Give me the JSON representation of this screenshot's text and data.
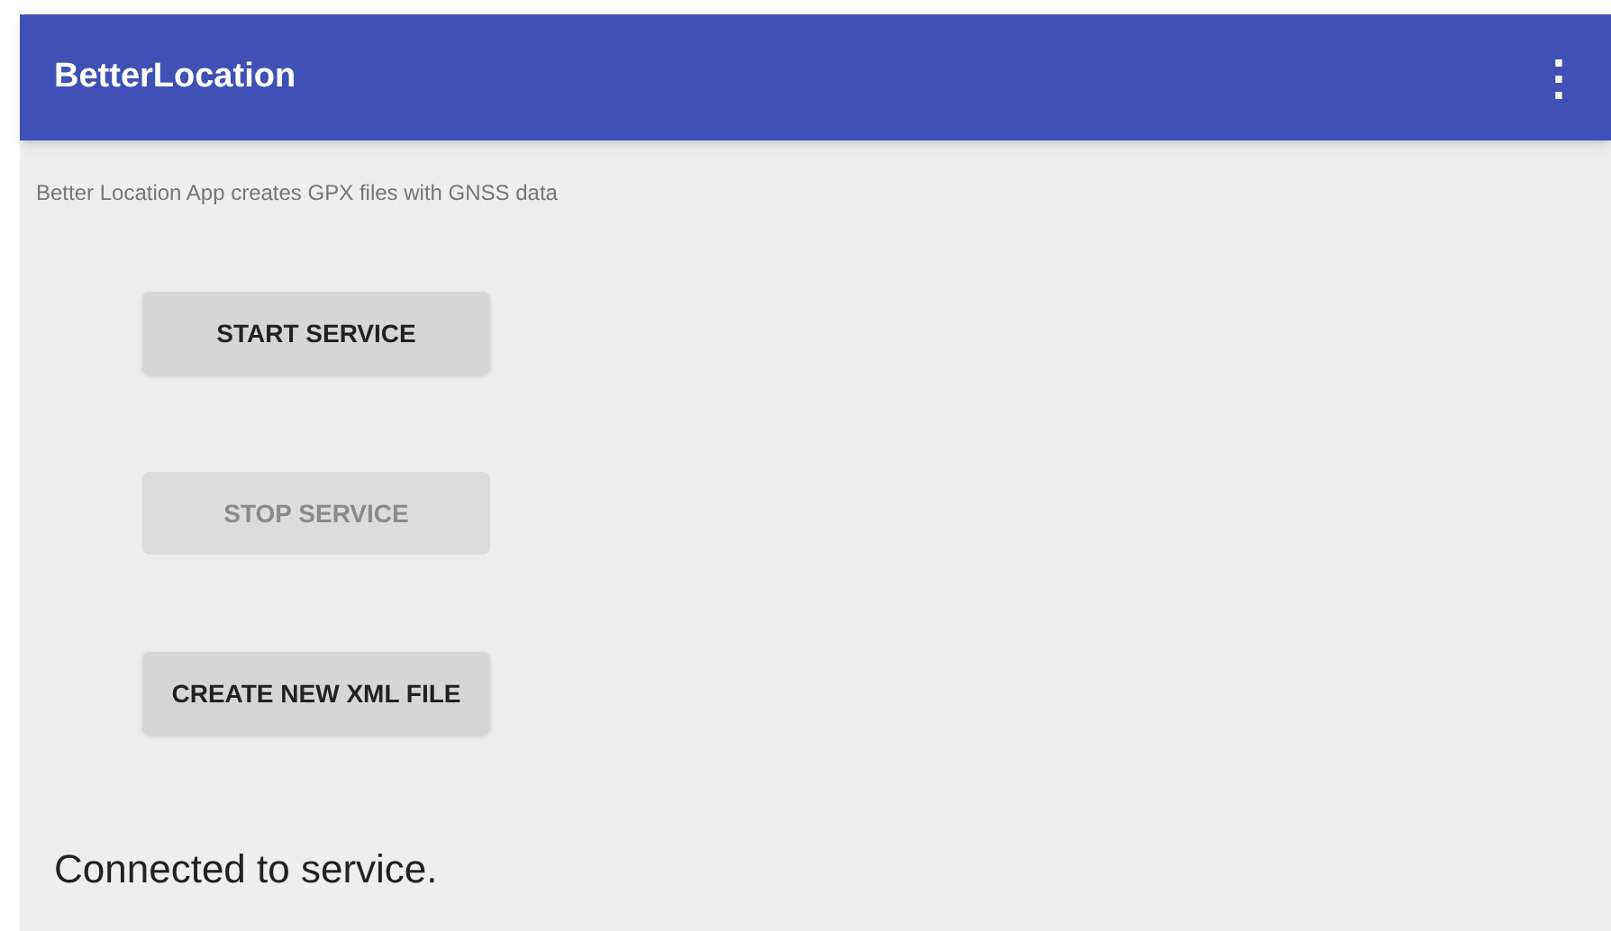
{
  "app_bar": {
    "title": "BetterLocation",
    "menu_icon": "⋮"
  },
  "description": "Better Location App creates GPX files with GNSS data",
  "buttons": [
    {
      "label": "START SERVICE",
      "disabled": false
    },
    {
      "label": "STOP SERVICE",
      "disabled": true
    },
    {
      "label": "CREATE NEW XML FILE",
      "disabled": false
    }
  ],
  "status": "Connected to service."
}
